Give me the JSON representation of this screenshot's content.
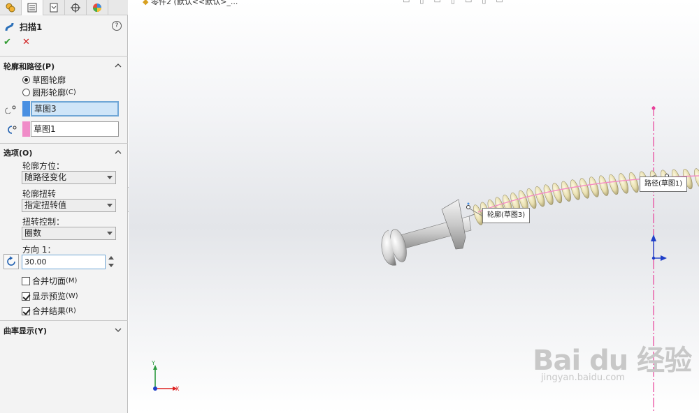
{
  "panel": {
    "feature_title": "扫描1",
    "help_icon": "help-icon",
    "tabs": [
      "feature-manager-icon",
      "property-manager-icon",
      "configuration-manager-icon",
      "dimxpert-icon",
      "display-manager-icon"
    ],
    "section_profile_path": {
      "title": "轮廓和路径(P)",
      "radio_sketch": "草图轮廓",
      "radio_circle_text": "圆形轮廓",
      "radio_circle_key": "(C)",
      "profile_value": "草图3",
      "path_value": "草图1",
      "profile_color": "#4a90e2",
      "path_color": "#f08cc8"
    },
    "section_options": {
      "title": "选项(O)",
      "orientation_label": "轮廓方位：",
      "orientation_value": "随路径变化",
      "twist_label": "轮廓扭转",
      "twist_value": "指定扭转值",
      "twist_control_label": "扭转控制：",
      "twist_control_value": "圈数",
      "direction_label": "方向 1：",
      "angle_value": "30.00",
      "merge_tangent_text": "合并切面",
      "merge_tangent_key": "(M)",
      "show_preview_text": "显示预览",
      "show_preview_key": "(W)",
      "merge_result_text": "合并结果",
      "merge_result_key": "(R)",
      "merge_tangent_checked": false,
      "show_preview_checked": true,
      "merge_result_checked": true
    },
    "section_curvature": {
      "title": "曲率显示(Y)"
    }
  },
  "viewport": {
    "doc_title": "零件2 (默认<<默认>_...",
    "callout_profile": "轮廓(草图3)",
    "callout_path": "路径(草图1)",
    "axis_y": "Y",
    "axis_x": "X",
    "watermark_logo": "Bai du 经验",
    "watermark_url": "jingyan.baidu.com"
  }
}
